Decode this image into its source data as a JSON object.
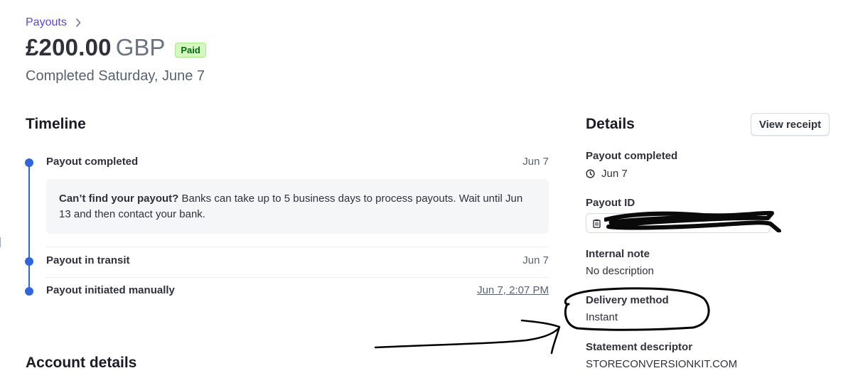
{
  "breadcrumb": {
    "label": "Payouts"
  },
  "header": {
    "amount": "£200.00",
    "currency": "GBP",
    "status": "Paid",
    "completed_text": "Completed Saturday, June 7"
  },
  "timeline": {
    "title": "Timeline",
    "events": [
      {
        "label": "Payout completed",
        "date": "Jun 7"
      },
      {
        "label": "Payout in transit",
        "date": "Jun 7"
      },
      {
        "label": "Payout initiated manually",
        "date": "Jun 7, 2:07 PM"
      }
    ],
    "notice": {
      "bold": "Can’t find your payout?",
      "text": " Banks can take up to 5 business days to process payouts. Wait until Jun 13 and then contact your bank."
    }
  },
  "account": {
    "title": "Account details"
  },
  "details": {
    "title": "Details",
    "view_receipt": "View receipt",
    "payout_completed_label": "Payout completed",
    "payout_completed_value": "Jun 7",
    "payout_id_label": "Payout ID",
    "internal_note_label": "Internal note",
    "internal_note_value": "No description",
    "delivery_method_label": "Delivery method",
    "delivery_method_value": "Instant",
    "statement_descriptor_label": "Statement descriptor",
    "statement_descriptor_value": "STORECONVERSIONKIT.COM"
  },
  "colors": {
    "accent": "#5b45e0",
    "timeline": "#2f66db",
    "badge_bg": "#d7f7c2",
    "badge_text": "#05690d"
  },
  "icons": [
    "chevron-right-icon",
    "clock-icon",
    "clipboard-icon"
  ]
}
